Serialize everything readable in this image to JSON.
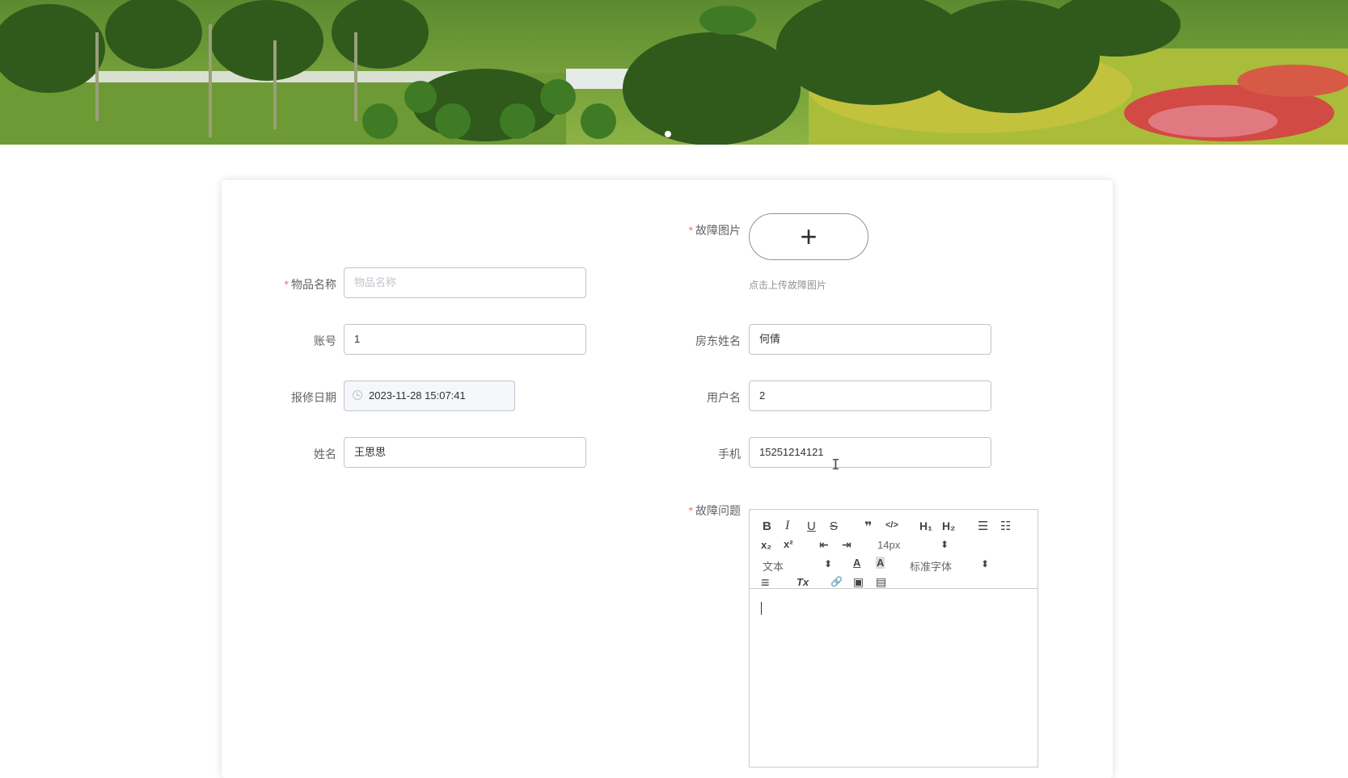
{
  "banner": {
    "image_alt": "garden landscape banner",
    "carousel_dots": 1
  },
  "form": {
    "fault_image": {
      "label": "故障图片",
      "required": true,
      "upload_hint": "点击上传故障图片",
      "upload_icon": "plus-icon",
      "upload_symbol": "+"
    },
    "item_name": {
      "label": "物品名称",
      "required": true,
      "value": "",
      "placeholder": "物品名称"
    },
    "account": {
      "label": "账号",
      "value": "1"
    },
    "landlord_name": {
      "label": "房东姓名",
      "value": "何倩"
    },
    "repair_date": {
      "label": "报修日期",
      "value": "2023-11-28 15:07:41",
      "icon": "clock-icon"
    },
    "username": {
      "label": "用户名",
      "value": "2"
    },
    "name": {
      "label": "姓名",
      "value": "王思思"
    },
    "phone": {
      "label": "手机",
      "value": "15251214121"
    },
    "fault_issue": {
      "label": "故障问题",
      "required": true,
      "toolbar": {
        "bold": "B",
        "italic": "I",
        "underline": "U",
        "strike": "S",
        "blockquote": "❞",
        "code": "</>",
        "h1": "H₁",
        "h2": "H₂",
        "ordered_list": "☰",
        "bullet_list": "☷",
        "subscript": "x₂",
        "superscript": "x²",
        "outdent": "⇤",
        "indent": "⇥",
        "font_size": "14px",
        "header": "文本",
        "font_color": "A",
        "background": "A",
        "font_family": "标准字体",
        "align": "≡",
        "clean": "Tx",
        "link": "🔗",
        "image": "▣",
        "video": "▤"
      },
      "content": ""
    }
  }
}
